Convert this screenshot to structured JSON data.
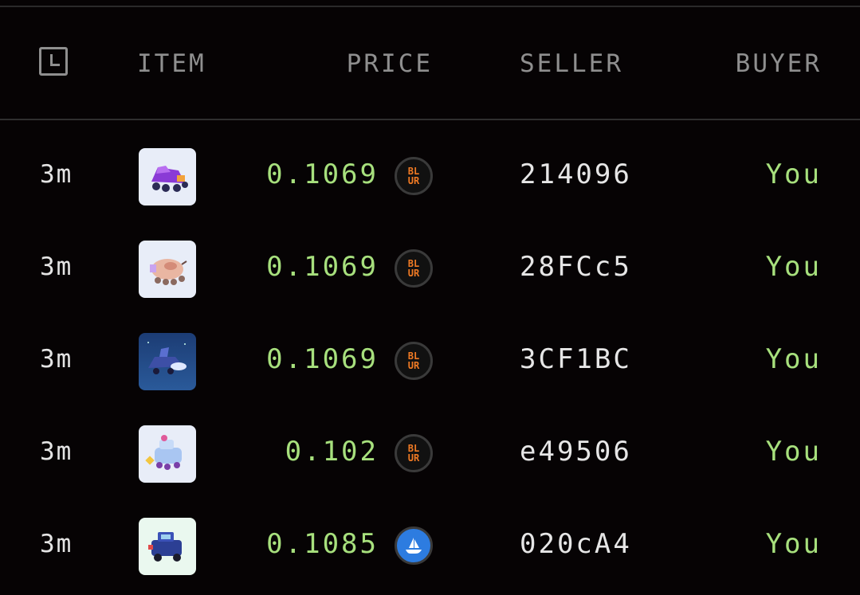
{
  "header": {
    "time_icon": "clock-icon",
    "item": "ITEM",
    "price": "PRICE",
    "seller": "SELLER",
    "buyer": "BUYER"
  },
  "rows": [
    {
      "time": "3m",
      "price": "0.1069",
      "marketplace": "blur",
      "blur_top": "BL",
      "blur_bottom": "UR",
      "seller": "214096",
      "buyer": "You"
    },
    {
      "time": "3m",
      "price": "0.1069",
      "marketplace": "blur",
      "blur_top": "BL",
      "blur_bottom": "UR",
      "seller": "28FCc5",
      "buyer": "You"
    },
    {
      "time": "3m",
      "price": "0.1069",
      "marketplace": "blur",
      "blur_top": "BL",
      "blur_bottom": "UR",
      "seller": "3CF1BC",
      "buyer": "You"
    },
    {
      "time": "3m",
      "price": "0.102",
      "marketplace": "blur",
      "blur_top": "BL",
      "blur_bottom": "UR",
      "seller": "e49506",
      "buyer": "You"
    },
    {
      "time": "3m",
      "price": "0.1085",
      "marketplace": "opensea",
      "seller": "020cA4",
      "buyer": "You"
    }
  ],
  "colors": {
    "background": "#060304",
    "price_green": "#a7e07d",
    "header_gray": "#8f8f8f",
    "blur_orange": "#f07a24",
    "opensea_blue": "#2d7ce0"
  }
}
